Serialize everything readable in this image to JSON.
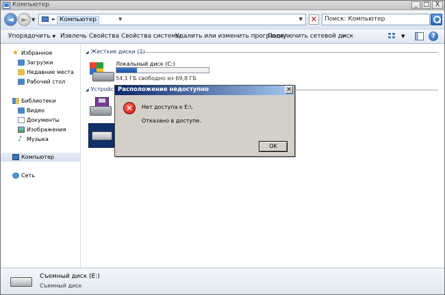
{
  "window": {
    "title": "Компьютер",
    "controls": {
      "minimize": "_",
      "maximize": "□",
      "close": "X"
    }
  },
  "address": {
    "crumb": "Компьютер",
    "search_placeholder": "Поиск: Компьютер"
  },
  "toolbar": {
    "organize": "Упорядочить",
    "eject": "Извлечь",
    "properties": "Свойства",
    "system_properties": "Свойства системы",
    "uninstall": "Удалить или изменить программу",
    "map_drive": "Подключить сетевой диск",
    "more": "»"
  },
  "sidebar": {
    "favorites": "Избранное",
    "downloads": "Загрузки",
    "recent": "Недавние места",
    "desktop": "Рабочий стол",
    "libraries": "Библиотеки",
    "video": "Видео",
    "documents": "Документы",
    "images": "Изображения",
    "music": "Музыка",
    "computer": "Компьютер",
    "network": "Сеть"
  },
  "content": {
    "hdd_group": "Жесткие диски (1)",
    "devices_group": "Устройств",
    "drive_c": {
      "name": "Локальный диск (C:)",
      "free_text": "54,1 ГБ свободно из 69,8 ГБ",
      "used_fraction": 0.22
    }
  },
  "details": {
    "name": "Съемный диск (E:)",
    "type": "Съемный диск"
  },
  "dialog": {
    "title": "Расположение недоступно",
    "message1": "Нет доступа к E:\\.",
    "message2": "Отказано в доступе.",
    "ok": "OK"
  },
  "colors": {
    "dialog_title_start": "#0a246a",
    "dialog_title_end": "#a6caf0",
    "error_red": "#c2160b",
    "capacity_fill": "#1e4f9a"
  }
}
